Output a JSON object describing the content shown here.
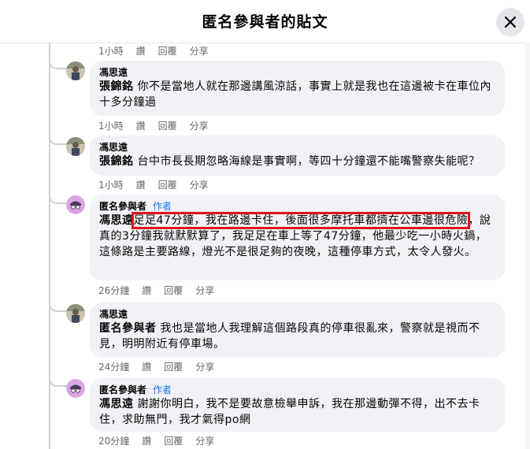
{
  "header": {
    "title": "匿名參與者的貼文"
  },
  "top_actions": {
    "time": "1小時",
    "like": "讚",
    "reply": "回覆",
    "share": "分享"
  },
  "comments": [
    {
      "author": "馮思遠",
      "badge": "",
      "mention": "張錦銘",
      "text": "你不是當地人就在那邊講風涼話，事實上就是我也在這邊被卡在車位內十多分鐘過",
      "time": "1小時",
      "like": "讚",
      "reply": "回覆",
      "share": "分享"
    },
    {
      "author": "馮思遠",
      "badge": "",
      "mention": "張錦銘",
      "text": "台中市長長期忽略海線是事實啊，等四十分鐘還不能嘴警察失能呢？",
      "time": "1小時",
      "like": "讚",
      "reply": "回覆",
      "share": "分享"
    },
    {
      "author": "匿名參與者",
      "badge": "作者",
      "mention": "馮思遠",
      "text_highlighted": "足足47分鐘，我在路邊卡住，後面很多摩托車都擠在公車邊很危險",
      "text": "，說真的3分鐘我就默默算了，我足足在車上等了47分鐘，他最少吃一小時火鍋，這條路是主要路線，燈光不是很足夠的夜晚，這種停車方式，太令人發火。",
      "time": "26分鐘",
      "like": "讚",
      "reply": "回覆",
      "share": "分享"
    },
    {
      "author": "馮思遠",
      "badge": "",
      "mention": "匿名參與者",
      "text": "我也是當地人我理解這個路段真的停車很亂來，警察就是視而不見，明明附近有停車場。",
      "time": "24分鐘",
      "like": "讚",
      "reply": "回覆",
      "share": "分享"
    },
    {
      "author": "匿名參與者",
      "badge": "作者",
      "mention": "馮思遠",
      "text": "謝謝你明白，我不是要故意檢舉申訴，我在那邊動彈不得，出不去卡住，求助無門，我才氣得po網",
      "time": "20分鐘",
      "like": "讚",
      "reply": "回覆",
      "share": "分享"
    }
  ],
  "colors": {
    "highlight_box": "#e0111f",
    "author_badge": "#1877f2",
    "bubble": "#f0f2f5"
  },
  "icons": {
    "close": "close-icon",
    "avatar_photo": "user-photo-avatar",
    "avatar_anon": "anonymous-participant-avatar"
  }
}
